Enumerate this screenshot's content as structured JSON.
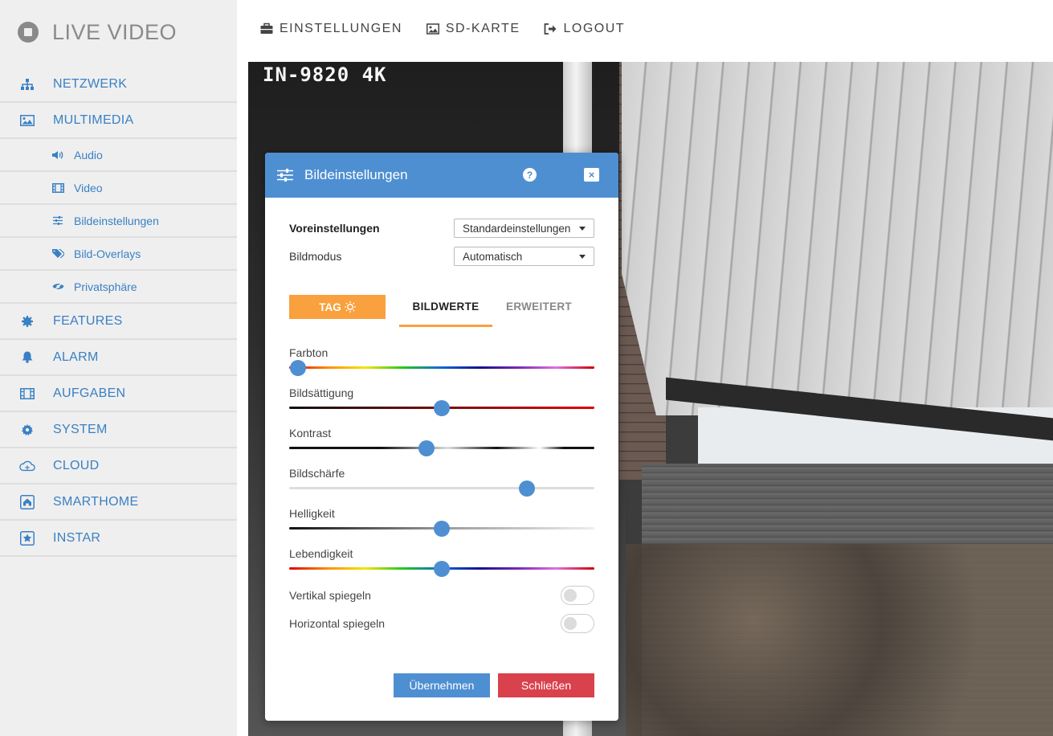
{
  "brand": {
    "title": "LIVE VIDEO"
  },
  "sidebar": {
    "items": [
      {
        "label": "NETZWERK",
        "icon": "sitemap-icon"
      },
      {
        "label": "MULTIMEDIA",
        "icon": "image-icon"
      },
      {
        "label": "Audio",
        "icon": "volume-icon"
      },
      {
        "label": "Video",
        "icon": "film-icon"
      },
      {
        "label": "Bildeinstellungen",
        "icon": "sliders-icon"
      },
      {
        "label": "Bild-Overlays",
        "icon": "tags-icon"
      },
      {
        "label": "Privatsphäre",
        "icon": "eye-slash-icon"
      },
      {
        "label": "FEATURES",
        "icon": "cog-badge-icon"
      },
      {
        "label": "ALARM",
        "icon": "bell-icon"
      },
      {
        "label": "AUFGABEN",
        "icon": "film-icon"
      },
      {
        "label": "SYSTEM",
        "icon": "gear-icon"
      },
      {
        "label": "CLOUD",
        "icon": "cloud-icon"
      },
      {
        "label": "SMARTHOME",
        "icon": "home-icon"
      },
      {
        "label": "INSTAR",
        "icon": "star-icon"
      }
    ]
  },
  "topnav": {
    "settings": "EINSTELLUNGEN",
    "sdcard": "SD-KARTE",
    "logout": "LOGOUT"
  },
  "video": {
    "camera_label": "IN-9820 4K"
  },
  "dialog": {
    "title": "Bildeinstellungen",
    "help": "?",
    "close": "×",
    "presets_label": "Voreinstellungen",
    "presets_value": "Standardeinstellungen",
    "mode_label": "Bildmodus",
    "mode_value": "Automatisch",
    "tab_day": "TAG",
    "tab_values": "BILDWERTE",
    "tab_advanced": "ERWEITERT",
    "sliders": {
      "hue": {
        "label": "Farbton",
        "value": 0.03
      },
      "saturation": {
        "label": "Bildsättigung",
        "value": 0.5
      },
      "contrast": {
        "label": "Kontrast",
        "value": 0.45
      },
      "sharpness": {
        "label": "Bildschärfe",
        "value": 0.78
      },
      "brightness": {
        "label": "Helligkeit",
        "value": 0.5
      },
      "vibrance": {
        "label": "Lebendigkeit",
        "value": 0.5
      }
    },
    "flip_vertical": "Vertikal spiegeln",
    "flip_horizontal": "Horizontal spiegeln",
    "apply": "Übernehmen",
    "close_btn": "Schließen"
  },
  "colors": {
    "accent_blue": "#4e8fd2",
    "link_blue": "#3a80c4",
    "orange": "#f9a03f",
    "red": "#d9414c"
  }
}
